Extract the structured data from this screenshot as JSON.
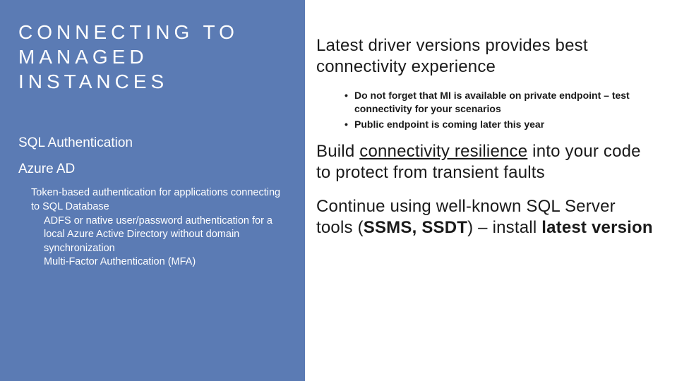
{
  "left": {
    "title": "CONNECTING TO MANAGED INSTANCES",
    "sub1": "SQL Authentication",
    "sub2": "Azure AD",
    "body1": "Token-based authentication for applications connecting to SQL Database",
    "body2": "ADFS or native user/password authentication for a local Azure Active Directory without domain synchronization",
    "body3": "Multi-Factor Authentication (MFA)"
  },
  "right": {
    "heading1": "Latest driver versions provides best connectivity experience",
    "bullet1": "Do not forget that MI is available on private endpoint – test connectivity for your scenarios",
    "bullet2": "Public endpoint is coming later this year",
    "heading2_pre": "Build ",
    "heading2_link": "connectivity resilience",
    "heading2_post": " into your code to protect from transient faults",
    "heading3_pre": "Continue using well-known SQL Server tools (",
    "heading3_bold1": "SSMS, SSDT",
    "heading3_mid": ") – install ",
    "heading3_bold2": "latest version"
  }
}
